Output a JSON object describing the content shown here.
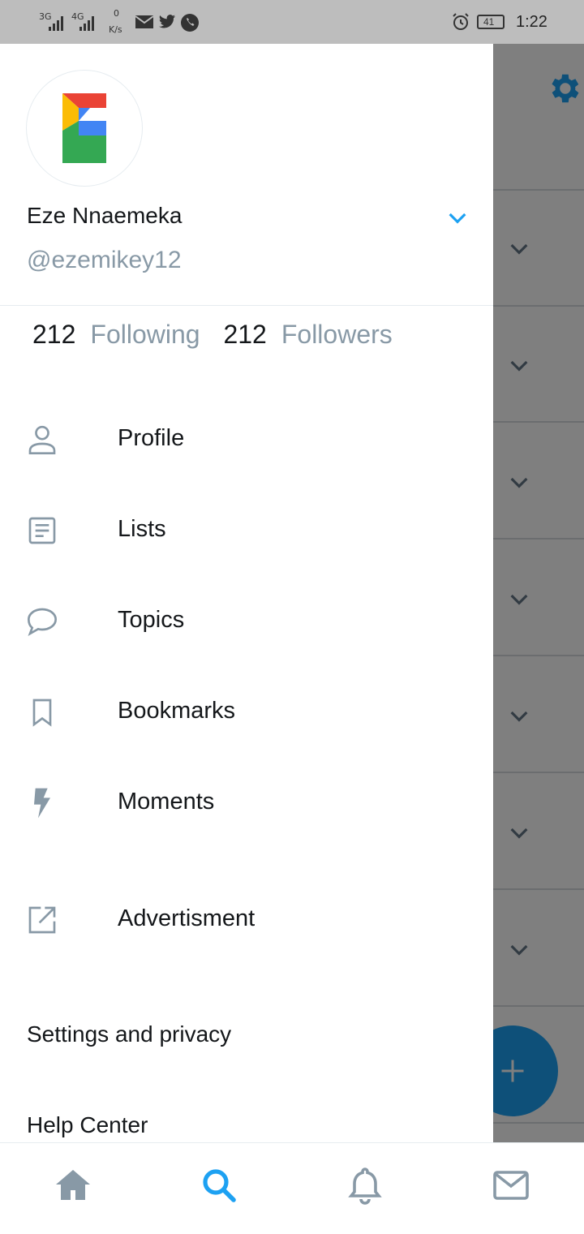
{
  "status_bar": {
    "network1": "3G",
    "network2": "4G",
    "speed_value": "0",
    "speed_unit": "K/s",
    "battery": "41",
    "time": "1:22"
  },
  "drawer": {
    "user": {
      "name": "Eze Nnaemeka",
      "handle": "@ezemikey12"
    },
    "stats": {
      "following_count": "212",
      "following_label": "Following",
      "followers_count": "212",
      "followers_label": "Followers"
    },
    "menu": [
      {
        "label": "Profile",
        "icon": "person-icon"
      },
      {
        "label": "Lists",
        "icon": "list-icon"
      },
      {
        "label": "Topics",
        "icon": "speech-bubble-icon"
      },
      {
        "label": "Bookmarks",
        "icon": "bookmark-icon"
      },
      {
        "label": "Moments",
        "icon": "lightning-icon"
      },
      {
        "label": "Advertisment",
        "icon": "external-link-icon"
      }
    ],
    "settings_label": "Settings and privacy",
    "help_label": "Help Center"
  },
  "bottom_nav": {
    "items": [
      "home-icon",
      "search-icon",
      "bell-icon",
      "mail-icon"
    ],
    "active": "search-icon"
  },
  "colors": {
    "accent": "#1da1f2",
    "secondary_text": "#8899a6",
    "icon_gray": "#8899a6"
  }
}
